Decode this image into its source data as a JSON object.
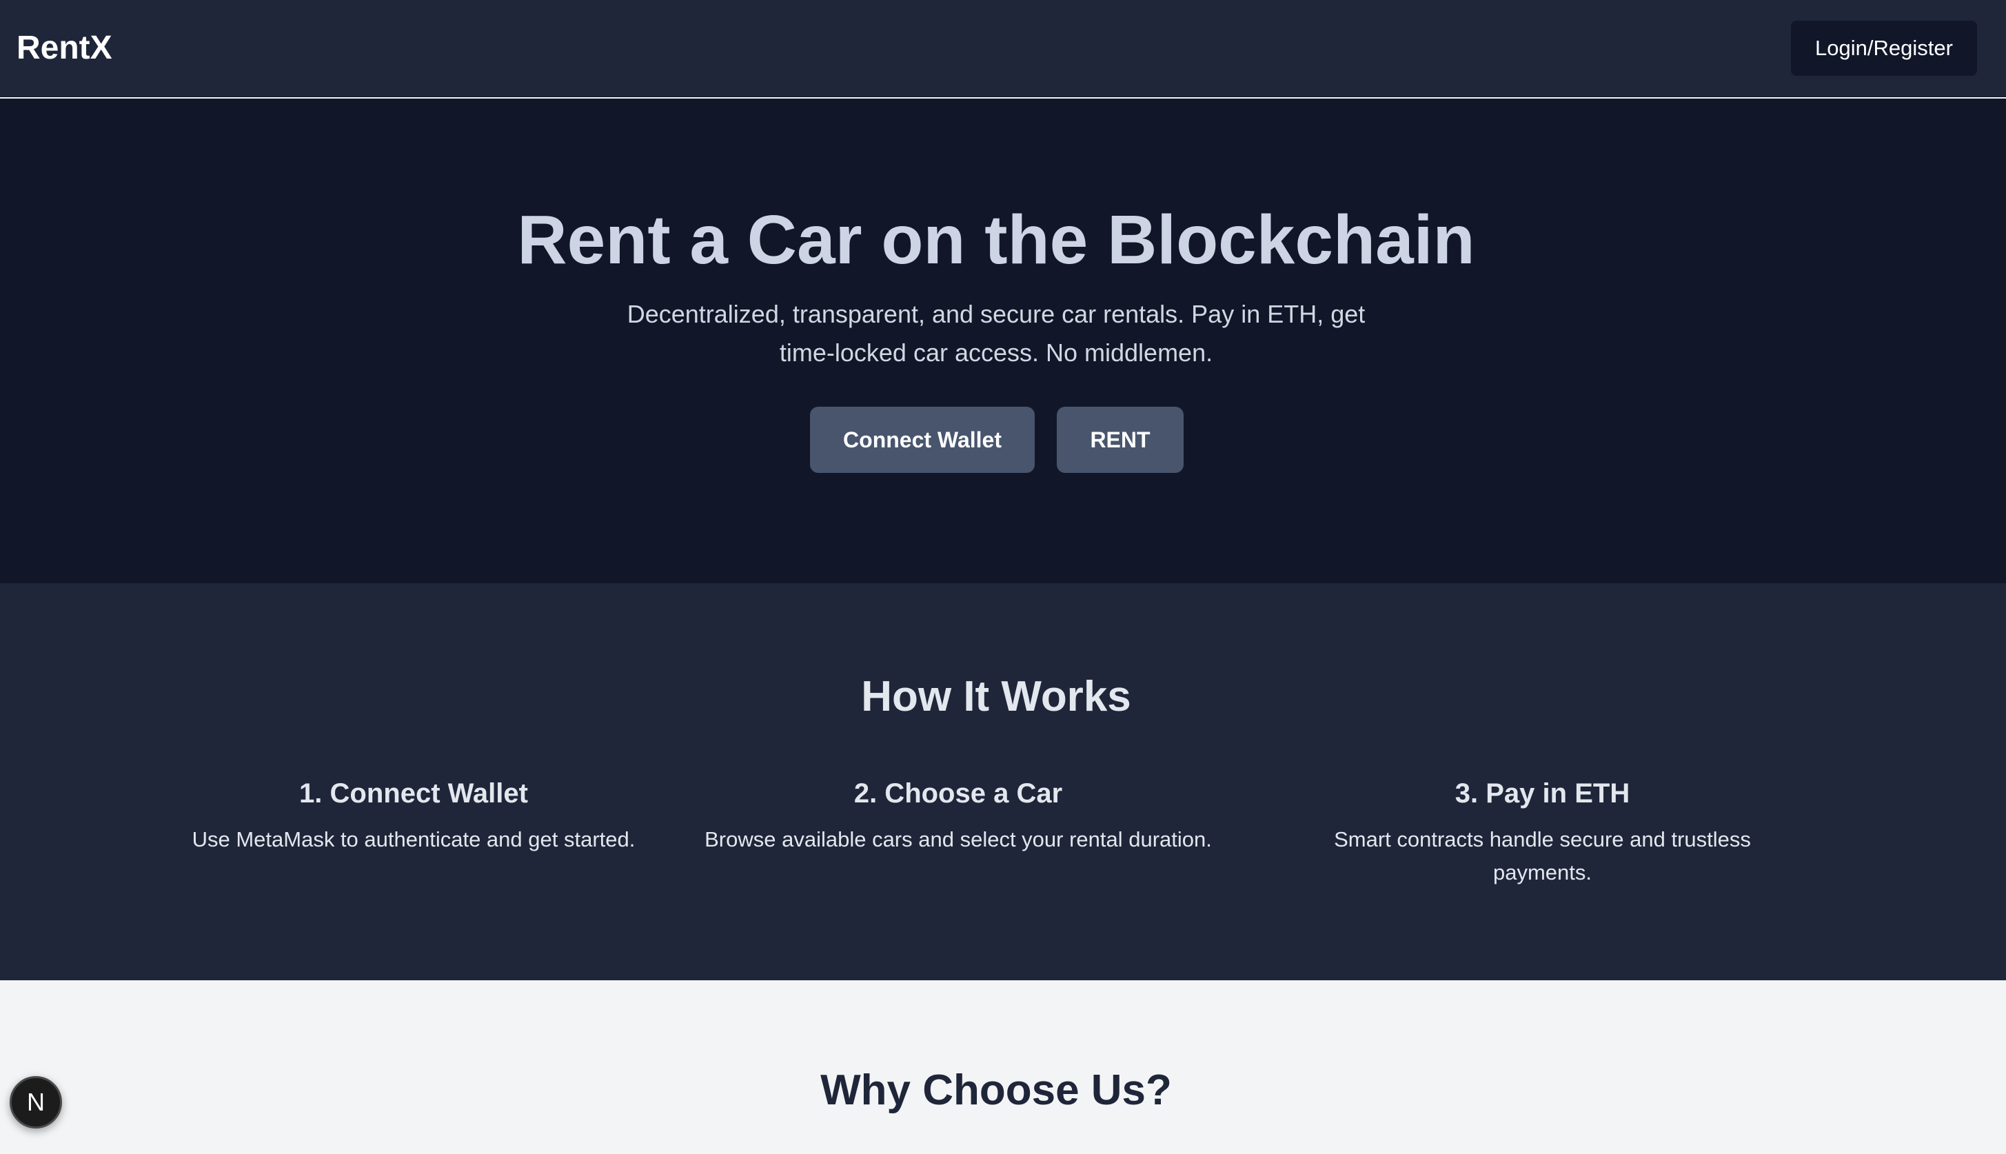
{
  "navbar": {
    "brand": "RentX",
    "login_label": "Login/Register"
  },
  "hero": {
    "title": "Rent a Car on the Blockchain",
    "subtitle": "Decentralized, transparent, and secure car rentals. Pay in ETH, get time-locked car access. No middlemen.",
    "connect_label": "Connect Wallet",
    "rent_label": "RENT"
  },
  "how_it_works": {
    "title": "How It Works",
    "steps": [
      {
        "title": "1. Connect Wallet",
        "desc": "Use MetaMask to authenticate and get started."
      },
      {
        "title": "2. Choose a Car",
        "desc": "Browse available cars and select your rental duration."
      },
      {
        "title": "3. Pay in ETH",
        "desc": "Smart contracts handle secure and trustless payments."
      }
    ]
  },
  "why": {
    "title": "Why Choose Us?"
  },
  "devtools": {
    "badge_letter": "N"
  },
  "colors": {
    "nav_bg": "#1f2639",
    "hero_bg": "#111729",
    "button_bg": "#48556d",
    "light_bg": "#f3f4f6"
  }
}
